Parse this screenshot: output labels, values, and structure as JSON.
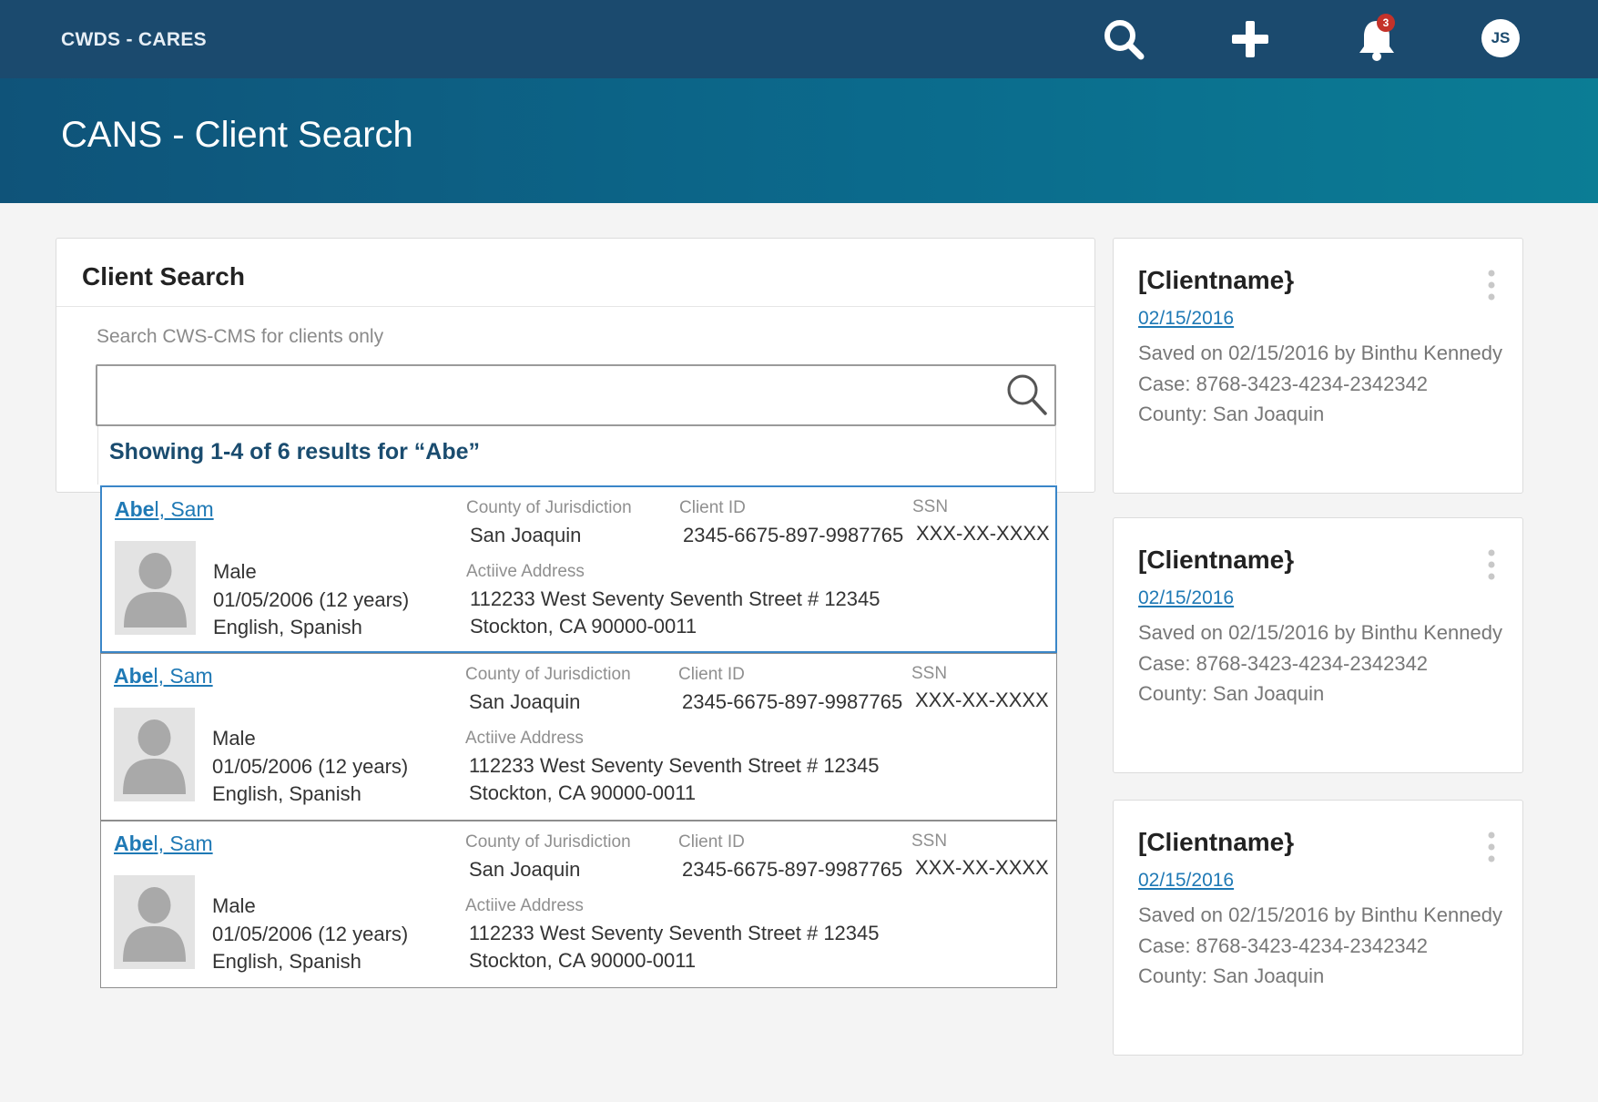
{
  "topbar": {
    "brand": "CWDS - CARES",
    "notification_count": "3",
    "user_initials": "JS",
    "icons": [
      "search-icon",
      "plus-icon",
      "bell-icon"
    ]
  },
  "hero": {
    "title": "CANS - Client Search"
  },
  "search": {
    "title": "Client Search",
    "label": "Search CWS-CMS for clients only",
    "value": "",
    "placeholder": "",
    "results_summary": "Showing 1-4 of 6 results for “Abe”"
  },
  "results": [
    {
      "name_match": "Abe",
      "name_rest": "l, Sam",
      "gender": "Male",
      "dob": "01/05/2006 (12 years)",
      "languages": "English, Spanish",
      "county_label": "County of Jurisdiction",
      "county": "San Joaquin",
      "client_id_label": "Client ID",
      "client_id": "2345-6675-897-9987765",
      "ssn_label": "SSN",
      "ssn": "XXX-XX-XXXX",
      "address_label": "Actiive Address",
      "address_line1": "112233 West Seventy Seventh Street # 12345",
      "address_line2": "Stockton, CA 90000-0011"
    },
    {
      "name_match": "Abe",
      "name_rest": "l, Sam",
      "gender": "Male",
      "dob": "01/05/2006 (12 years)",
      "languages": "English, Spanish",
      "county_label": "County of Jurisdiction",
      "county": "San Joaquin",
      "client_id_label": "Client ID",
      "client_id": "2345-6675-897-9987765",
      "ssn_label": "SSN",
      "ssn": "XXX-XX-XXXX",
      "address_label": "Actiive Address",
      "address_line1": "112233 West Seventy Seventh Street # 12345",
      "address_line2": "Stockton, CA 90000-0011"
    },
    {
      "name_match": "Abe",
      "name_rest": "l, Sam",
      "gender": "Male",
      "dob": "01/05/2006 (12 years)",
      "languages": "English, Spanish",
      "county_label": "County of Jurisdiction",
      "county": "San Joaquin",
      "client_id_label": "Client ID",
      "client_id": "2345-6675-897-9987765",
      "ssn_label": "SSN",
      "ssn": "XXX-XX-XXXX",
      "address_label": "Actiive Address",
      "address_line1": "112233 West Seventy Seventh Street # 12345",
      "address_line2": "Stockton, CA 90000-0011"
    }
  ],
  "recent": [
    {
      "title": "[Clientname}",
      "date": "02/15/2016",
      "saved": "Saved on 02/15/2016 by Binthu Kennedy",
      "case": "Case: 8768-3423-4234-2342342",
      "county": "County: San Joaquin"
    },
    {
      "title": "[Clientname}",
      "date": "02/15/2016",
      "saved": "Saved on 02/15/2016 by Binthu Kennedy",
      "case": "Case: 8768-3423-4234-2342342",
      "county": "County: San Joaquin"
    },
    {
      "title": "[Clientname}",
      "date": "02/15/2016",
      "saved": "Saved on 02/15/2016 by Binthu Kennedy",
      "case": "Case: 8768-3423-4234-2342342",
      "county": "County: San Joaquin"
    }
  ],
  "colors": {
    "topbar": "#1b4a6e",
    "hero_start": "#0f5379",
    "hero_end": "#0b7d95",
    "link": "#1f79b5",
    "selected_border": "#3a86c8",
    "badge": "#c4322a"
  }
}
